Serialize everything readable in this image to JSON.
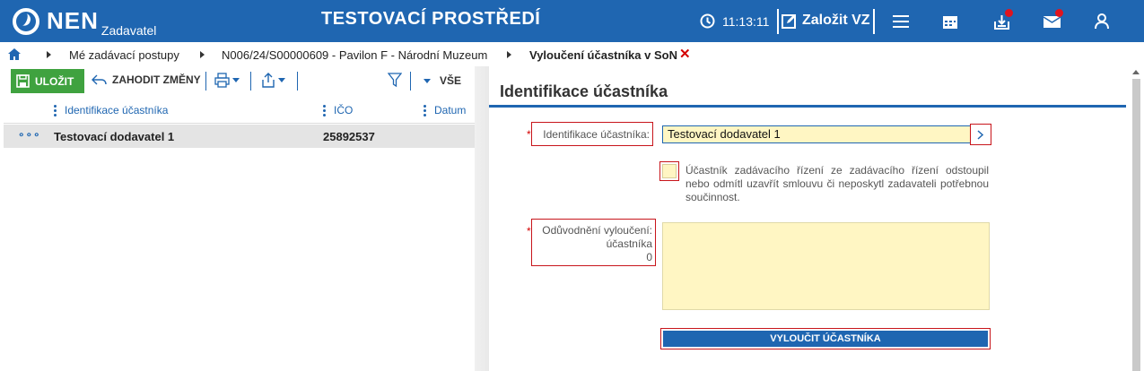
{
  "header": {
    "logo_text": "NEN",
    "logo_sub": "Zadavatel",
    "environment": "TESTOVACÍ PROSTŘEDÍ",
    "time": "11:13:11",
    "create_label": "Založit VZ",
    "icons": [
      "clock-icon",
      "edit-icon",
      "menu-icon",
      "calendar-icon",
      "inbox-icon",
      "mail-icon",
      "user-icon"
    ],
    "colors": {
      "bar": "#1f66b1",
      "badge": "#e0141e"
    }
  },
  "breadcrumb": {
    "items": [
      "Mé zadávací postupy",
      "N006/24/S00000609 - Pavilon F - Národní Muzeum",
      "Vyloučení účastníka v SoN"
    ]
  },
  "toolbar": {
    "save_label": "ULOŽIT",
    "discard_label": "ZAHODIT ZMĚNY",
    "all_label": "VŠE"
  },
  "grid": {
    "columns": [
      "Identifikace účastníka",
      "IČO",
      "Datum"
    ],
    "rows": [
      {
        "name": "Testovací dodavatel 1",
        "ico": "25892537",
        "date": ""
      }
    ]
  },
  "form": {
    "title": "Identifikace účastníka",
    "participant_label": "Identifikace účastníka:",
    "participant_value": "Testovací dodavatel 1",
    "withdraw_text": "Účastník zadávacího řízení ze zadávacího řízení odstoupil nebo odmítl uzavřít smlouvu či neposkytl zadavateli potřebnou součinnost.",
    "reason_label_1": "Odůvodnění vyloučení:",
    "reason_label_2": "účastníka",
    "reason_count": "0",
    "exclude_button": "VYLOUČIT ÚČASTNÍKA",
    "colors": {
      "input_bg": "#fff6c3",
      "error_border": "#c8151b"
    }
  }
}
